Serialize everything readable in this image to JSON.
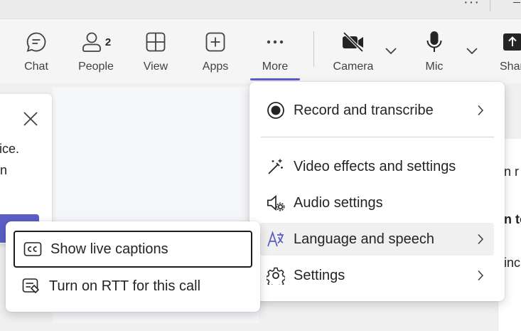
{
  "toolbar": {
    "chat_label": "Chat",
    "people_label": "People",
    "people_count": "2",
    "view_label": "View",
    "apps_label": "Apps",
    "more_label": "More",
    "camera_label": "Camera",
    "mic_label": "Mic",
    "share_label": "Shar",
    "accent_color": "#5b5fc7"
  },
  "notification": {
    "line1": "evice.",
    "line2": "n"
  },
  "right_panel": {
    "line1": "n r",
    "line2": "n to",
    "line3": "inc"
  },
  "more_menu": {
    "items": [
      {
        "label": "Record and transcribe",
        "icon": "record-icon",
        "has_submenu": true
      },
      {
        "label": "Video effects and settings",
        "icon": "magic-wand-icon",
        "has_submenu": false
      },
      {
        "label": "Audio settings",
        "icon": "speaker-gear-icon",
        "has_submenu": false
      },
      {
        "label": "Language and speech",
        "icon": "language-icon",
        "has_submenu": true
      },
      {
        "label": "Settings",
        "icon": "gear-icon",
        "has_submenu": true
      }
    ]
  },
  "language_submenu": {
    "items": [
      {
        "label": "Show live captions",
        "icon": "closed-captions-icon"
      },
      {
        "label": "Turn on RTT for this call",
        "icon": "rtt-icon"
      }
    ]
  }
}
